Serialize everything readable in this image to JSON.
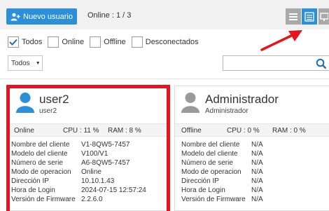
{
  "toolbar": {
    "new_user_label": "Nuevo usuario",
    "online_count": "Online : 1 / 3",
    "accent": "#2b90d9"
  },
  "filters": [
    {
      "label": "Todos",
      "checked": true
    },
    {
      "label": "Online",
      "checked": false
    },
    {
      "label": "Offline",
      "checked": false
    },
    {
      "label": "Desconectados",
      "checked": false
    }
  ],
  "select": {
    "value": "Todos"
  },
  "search": {
    "placeholder": ""
  },
  "cards": [
    {
      "name": "user2",
      "sub": "user2",
      "avatar_color": "#2b90d9",
      "status": "Online",
      "cpu": "CPU : 11 %",
      "ram": "RAM : 8 %",
      "fields": [
        {
          "k": "Nombre del cliente",
          "v": "V1-8QW5-7457"
        },
        {
          "k": "Modelo del cliente",
          "v": "V100/V1"
        },
        {
          "k": "Número de serie",
          "v": "A6-8QW5-7457"
        },
        {
          "k": "Modo de operacion",
          "v": "Online"
        },
        {
          "k": "Dirección IP",
          "v": "10.10.1.43"
        },
        {
          "k": "Hora de Login",
          "v": "2024-07-15 12:57:24"
        },
        {
          "k": "Versión de Firmware",
          "v": "2.2.6.0"
        }
      ]
    },
    {
      "name": "Administrador",
      "sub": "Administrador",
      "avatar_color": "#9a9a9a",
      "status": "Offline",
      "cpu": "CPU : 0 %",
      "ram": "RAM : 0 %",
      "fields": [
        {
          "k": "Nombre del cliente",
          "v": "N/A"
        },
        {
          "k": "Modelo del cliente",
          "v": "N/A"
        },
        {
          "k": "Número de serie",
          "v": "N/A"
        },
        {
          "k": "Modo de operacion",
          "v": "N/A"
        },
        {
          "k": "Dirección IP",
          "v": "N/A"
        },
        {
          "k": "Hora de Login",
          "v": "N/A"
        },
        {
          "k": "Versión de Firmware",
          "v": "N/A"
        }
      ]
    }
  ],
  "highlight_color": "#e8141b"
}
